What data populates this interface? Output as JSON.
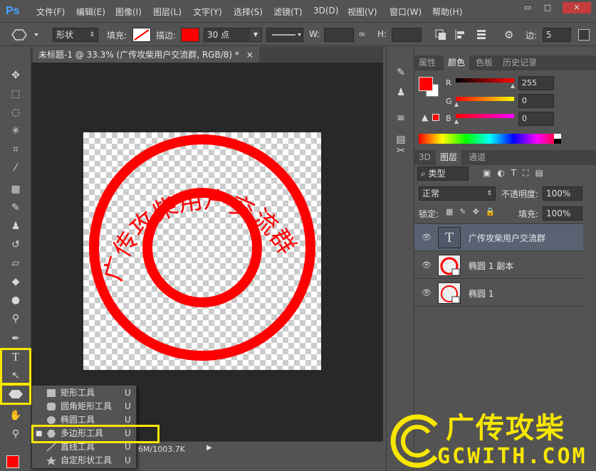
{
  "app": {
    "logo": "Ps"
  },
  "menu": [
    "文件(F)",
    "编辑(E)",
    "图像(I)",
    "图层(L)",
    "文字(Y)",
    "选择(S)",
    "滤镜(T)",
    "3D(D)",
    "视图(V)",
    "窗口(W)",
    "帮助(H)"
  ],
  "window_controls": {
    "minimize": "▭",
    "maximize": "□",
    "close": "✕"
  },
  "options": {
    "mode": "形状",
    "fill_label": "填充:",
    "stroke_label": "描边:",
    "stroke_color": "#ff0000",
    "stroke_size": "30 点",
    "w_label": "W:",
    "h_label": "H:",
    "sides_label": "边:",
    "sides_value": "5"
  },
  "document": {
    "tab_title": "未标题-1 @ 33.3% (广传攻柴用户交流群, RGB/8) *",
    "close": "×",
    "status_text": "6M/1003.7K",
    "stamp_text": "广传攻柴用户交流群",
    "stamp_color": "#ff0000"
  },
  "flyout": {
    "items": [
      {
        "label": "矩形工具",
        "key": "U",
        "icon": "rectangle-icon"
      },
      {
        "label": "圆角矩形工具",
        "key": "U",
        "icon": "rounded-rectangle-icon"
      },
      {
        "label": "椭圆工具",
        "key": "U",
        "icon": "ellipse-icon"
      },
      {
        "label": "多边形工具",
        "key": "U",
        "icon": "polygon-icon",
        "selected": true
      },
      {
        "label": "直线工具",
        "key": "U",
        "icon": "line-icon"
      },
      {
        "label": "自定形状工具",
        "key": "U",
        "icon": "custom-shape-icon"
      }
    ]
  },
  "color_panel": {
    "tabs": [
      "属性",
      "颜色",
      "色板",
      "历史记录"
    ],
    "active_tab": "颜色",
    "foreground": "#ff0000",
    "background": "#ffffff",
    "channels": [
      {
        "label": "R",
        "value": "255"
      },
      {
        "label": "G",
        "value": "0"
      },
      {
        "label": "B",
        "value": "0"
      }
    ]
  },
  "layers_panel": {
    "tabs": [
      "3D",
      "图层",
      "通道"
    ],
    "active_tab": "图层",
    "filter": "类型",
    "blend_mode": "正常",
    "opacity_label": "不透明度:",
    "opacity": "100%",
    "lock_label": "锁定:",
    "fill_label": "填充:",
    "fill": "100%",
    "layers": [
      {
        "name": "广传攻柴用户交流群",
        "type": "text",
        "selected": true
      },
      {
        "name": "椭圆 1 副本",
        "type": "shape",
        "selected": false
      },
      {
        "name": "椭圆 1",
        "type": "shape",
        "selected": false
      }
    ]
  },
  "watermark": {
    "main": "广传攻柴",
    "sub": "GCWITH.COM"
  }
}
